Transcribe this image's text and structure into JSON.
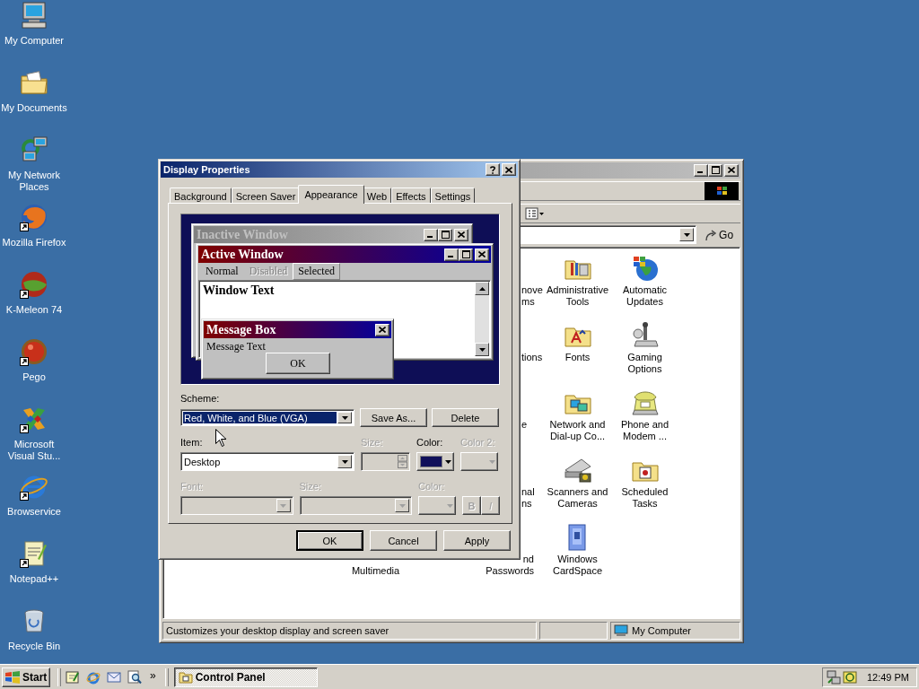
{
  "desktop_icons": [
    {
      "label": "My Computer",
      "shortcut": false
    },
    {
      "label": "My Documents",
      "shortcut": false
    },
    {
      "label": "My Network Places",
      "shortcut": false
    },
    {
      "label": "Mozilla Firefox",
      "shortcut": true
    },
    {
      "label": "K-Meleon 74",
      "shortcut": true
    },
    {
      "label": "Pego",
      "shortcut": true
    },
    {
      "label": "Microsoft Visual Stu...",
      "shortcut": true
    },
    {
      "label": "Browservice",
      "shortcut": true
    },
    {
      "label": "Notepad++",
      "shortcut": true
    },
    {
      "label": "Recycle Bin",
      "shortcut": false
    }
  ],
  "control_panel": {
    "go_button": "Go",
    "items": [
      {
        "label": "nove ms",
        "kind": "cut"
      },
      {
        "label": "Administrative Tools",
        "kind": "full"
      },
      {
        "label": "Automatic Updates",
        "kind": "full"
      },
      {
        "label": "tions",
        "kind": "cut"
      },
      {
        "label": "Fonts",
        "kind": "full"
      },
      {
        "label": "Gaming Options",
        "kind": "full"
      },
      {
        "label": "e",
        "kind": "cut"
      },
      {
        "label": "Network and Dial-up Co...",
        "kind": "full"
      },
      {
        "label": "Phone and Modem ...",
        "kind": "full"
      },
      {
        "label": "nal ns",
        "kind": "cut"
      },
      {
        "label": "Scanners and Cameras",
        "kind": "full"
      },
      {
        "label": "Scheduled Tasks",
        "kind": "full"
      },
      {
        "label": "Multimedia",
        "kind": "lower"
      },
      {
        "label": "nd Passwords",
        "kind": "cut-right"
      },
      {
        "label": "Windows CardSpace",
        "kind": "full"
      }
    ],
    "status_bar": {
      "description": "Customizes your desktop display and screen saver",
      "zone": "My Computer"
    }
  },
  "display_properties": {
    "title": "Display Properties",
    "tabs": [
      {
        "label": "Background",
        "selected": false
      },
      {
        "label": "Screen Saver",
        "selected": false
      },
      {
        "label": "Appearance",
        "selected": true
      },
      {
        "label": "Web",
        "selected": false
      },
      {
        "label": "Effects",
        "selected": false
      },
      {
        "label": "Settings",
        "selected": false
      }
    ],
    "preview": {
      "inactive_title": "Inactive Window",
      "active_title": "Active Window",
      "menu": [
        {
          "label": "Normal",
          "disabled": false,
          "selected": false
        },
        {
          "label": "Disabled",
          "disabled": true,
          "selected": false
        },
        {
          "label": "Selected",
          "disabled": false,
          "selected": true
        }
      ],
      "window_text": "Window Text",
      "message_title": "Message Box",
      "message_text": "Message Text",
      "ok": "OK"
    },
    "scheme": {
      "label": "Scheme:",
      "value": "Red, White, and Blue (VGA)",
      "buttons": [
        "Save As...",
        "Delete"
      ]
    },
    "item_row": [
      {
        "kind": "combo",
        "label": "Item:",
        "value": "Desktop",
        "disabled": false
      },
      {
        "kind": "spin",
        "label": "Size:",
        "disabled": true
      },
      {
        "kind": "color",
        "label": "Color:",
        "disabled": false,
        "color": "#10105a"
      },
      {
        "kind": "color",
        "label": "Color 2:",
        "disabled": true
      }
    ],
    "font_row": [
      {
        "kind": "combo",
        "label": "Font:",
        "disabled": true
      },
      {
        "kind": "combo",
        "label": "Size:",
        "disabled": true
      },
      {
        "kind": "color",
        "label": "Color:",
        "disabled": true
      },
      {
        "kind": "toggles",
        "buttons": [
          "B",
          "I"
        ],
        "disabled": true
      }
    ],
    "buttons": [
      {
        "label": "OK",
        "default": true
      },
      {
        "label": "Cancel",
        "default": false
      },
      {
        "label": "Apply",
        "default": false
      }
    ]
  },
  "taskbar": {
    "start": "Start",
    "more": "»",
    "tasks": [
      {
        "label": "Control Panel",
        "selected": true
      }
    ],
    "clock": "12:49 PM"
  }
}
